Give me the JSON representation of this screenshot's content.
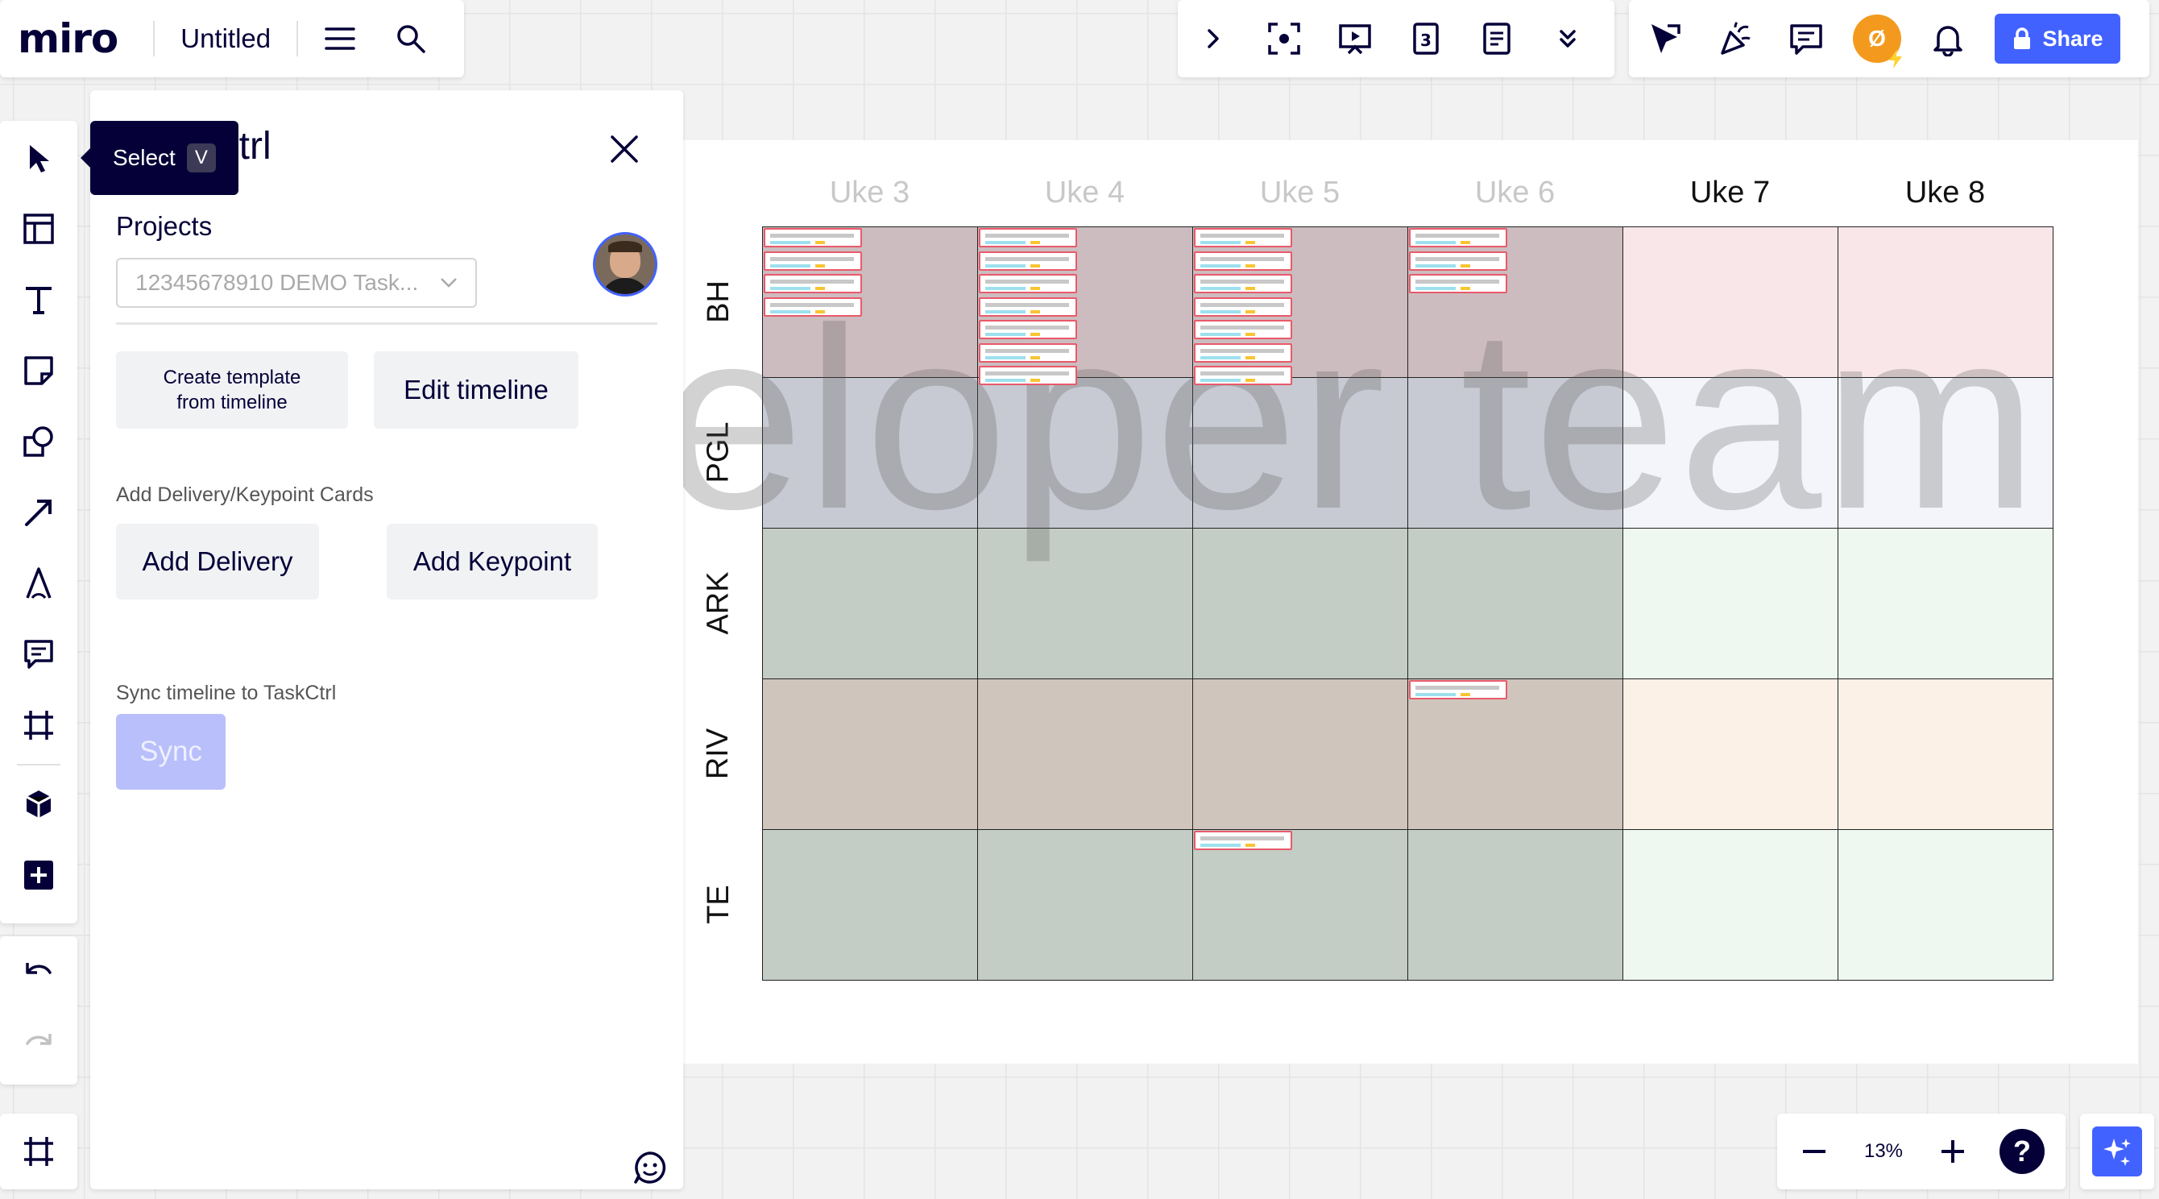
{
  "app": {
    "logo": "miro",
    "board_title": "Untitled"
  },
  "top_right": {
    "share_label": "Share",
    "avatar_initial": "Ø"
  },
  "tooltip": {
    "label": "Select",
    "shortcut": "V"
  },
  "panel": {
    "title": "TaskCtrl",
    "visible_title_fragment": "Ctrl",
    "projects_label": "Projects",
    "project_select_value": "12345678910 DEMO Task...",
    "create_template_label": "Create template from timeline",
    "edit_timeline_label": "Edit timeline",
    "cards_section_label": "Add Delivery/Keypoint Cards",
    "add_delivery_label": "Add Delivery",
    "add_keypoint_label": "Add Keypoint",
    "sync_section_label": "Sync timeline to TaskCtrl",
    "sync_label": "Sync"
  },
  "timeline": {
    "watermark_visible": "eloper team",
    "weeks": [
      {
        "label": "Uke 3",
        "past": true
      },
      {
        "label": "Uke 4",
        "past": true
      },
      {
        "label": "Uke 5",
        "past": true
      },
      {
        "label": "Uke 6",
        "past": true
      },
      {
        "label": "Uke 7",
        "past": false
      },
      {
        "label": "Uke 8",
        "past": false
      }
    ],
    "rows": [
      {
        "label": "BH",
        "past_color": "#cdbcbf",
        "future_color": "#f9e6e8"
      },
      {
        "label": "PGL",
        "past_color": "#c7cad2",
        "future_color": "#f3f5fb"
      },
      {
        "label": "ARK",
        "past_color": "#c4cdc5",
        "future_color": "#eef8f0"
      },
      {
        "label": "RIV",
        "past_color": "#d0c5bd",
        "future_color": "#fcf1e7"
      },
      {
        "label": "TE",
        "past_color": "#c3cdc5",
        "future_color": "#eef8f0"
      }
    ],
    "cards": [
      {
        "row": 0,
        "col": 0,
        "count": 4
      },
      {
        "row": 0,
        "col": 1,
        "count": 7
      },
      {
        "row": 0,
        "col": 2,
        "count": 7
      },
      {
        "row": 0,
        "col": 3,
        "count": 3
      },
      {
        "row": 3,
        "col": 3,
        "count": 1
      },
      {
        "row": 4,
        "col": 2,
        "count": 1
      }
    ]
  },
  "zoom": {
    "level": "13%"
  },
  "colors": {
    "accent": "#4262ff",
    "sync_disabled": "#b8bffb",
    "ink": "#050038"
  }
}
